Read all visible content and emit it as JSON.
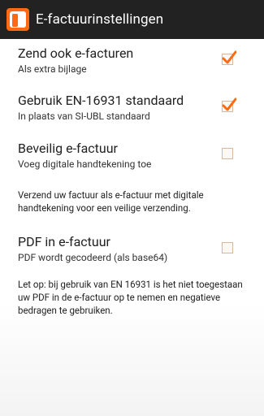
{
  "actionbar": {
    "title": "E-factuurinstellingen"
  },
  "preferences": [
    {
      "title": "Zend ook e-facturen",
      "summary": "Als extra bijlage",
      "checked": true
    },
    {
      "title": "Gebruik EN-16931 standaard",
      "summary": "In plaats van SI-UBL standaard",
      "checked": true
    },
    {
      "title": "Beveilig e-factuur",
      "summary": "Voeg digitale handtekening toe",
      "checked": false
    },
    {
      "title": "PDF in e-factuur",
      "summary": "PDF wordt gecodeerd (als base64)",
      "checked": false
    }
  ],
  "notes": {
    "signature": "Verzend uw factuur als e-factuur met digitale handtekening voor een veilige verzending.",
    "pdf": "Let op: bij gebruik van EN 16931 is het niet toegestaan uw PDF in de e-factuur op te nemen en negatieve bedragen te gebruiken."
  },
  "colors": {
    "accent": "#ff6a13",
    "actionbar": "#222222"
  }
}
